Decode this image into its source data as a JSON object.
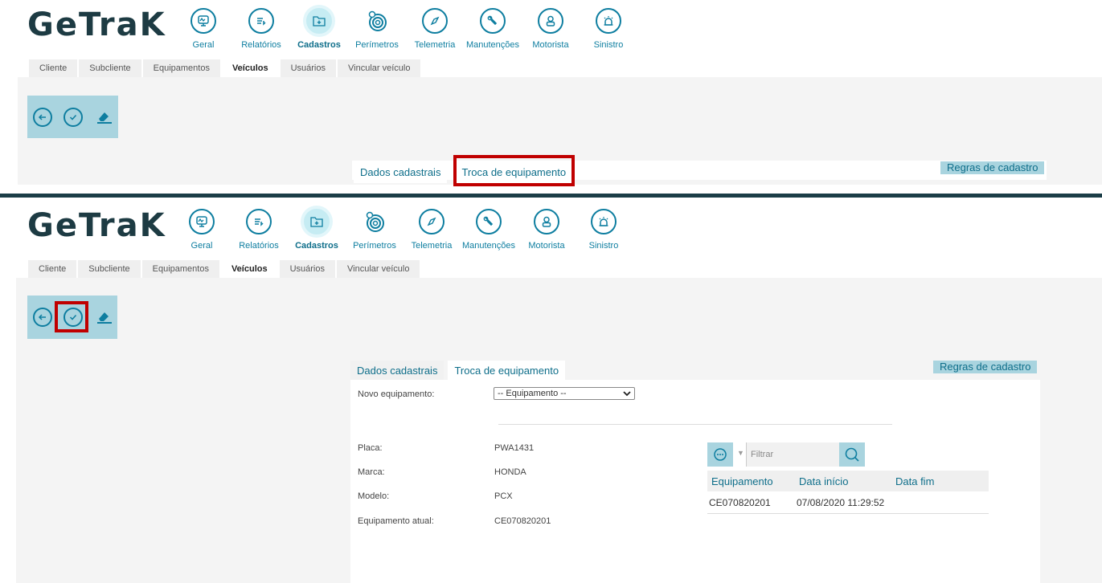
{
  "brand": {
    "logo_text": "GeTraK"
  },
  "nav": [
    {
      "label": "Geral",
      "icon": "monitor-chart-icon"
    },
    {
      "label": "Relatórios",
      "icon": "report-list-icon"
    },
    {
      "label": "Cadastros",
      "icon": "folder-plus-icon"
    },
    {
      "label": "Perímetros",
      "icon": "target-rings-icon"
    },
    {
      "label": "Telemetria",
      "icon": "compass-icon"
    },
    {
      "label": "Manutenções",
      "icon": "wrench-icon"
    },
    {
      "label": "Motorista",
      "icon": "driver-icon"
    },
    {
      "label": "Sinistro",
      "icon": "alarm-icon"
    }
  ],
  "subtabs": [
    "Cliente",
    "Subcliente",
    "Equipamentos",
    "Veículos",
    "Usuários",
    "Vincular veículo"
  ],
  "active_subtab": "Veículos",
  "toolbar": {
    "back": "back-icon",
    "confirm": "check-icon",
    "clear": "eraser-icon"
  },
  "form_tabs": [
    "Dados cadastrais",
    "Troca de equipamento"
  ],
  "rules_button": "Regras de cadastro",
  "form": {
    "novo_equipamento_label": "Novo equipamento:",
    "novo_equipamento_value": "-- Equipamento --",
    "placa_label": "Placa:",
    "placa_value": "PWA1431",
    "marca_label": "Marca:",
    "marca_value": "HONDA",
    "modelo_label": "Modelo:",
    "modelo_value": "PCX",
    "equip_atual_label": "Equipamento atual:",
    "equip_atual_value": "CE070820201"
  },
  "grid": {
    "filter_placeholder": "Filtrar",
    "columns": [
      "Equipamento",
      "Data início",
      "Data fim"
    ],
    "rows": [
      {
        "equipamento": "CE070820201",
        "data_inicio": "07/08/2020 11:29:52",
        "data_fim": ""
      }
    ]
  },
  "colors": {
    "accent": "#0e7ea0",
    "toolbar": "#a9d4df",
    "highlight": "#c00000",
    "divider": "#1b3d47"
  }
}
